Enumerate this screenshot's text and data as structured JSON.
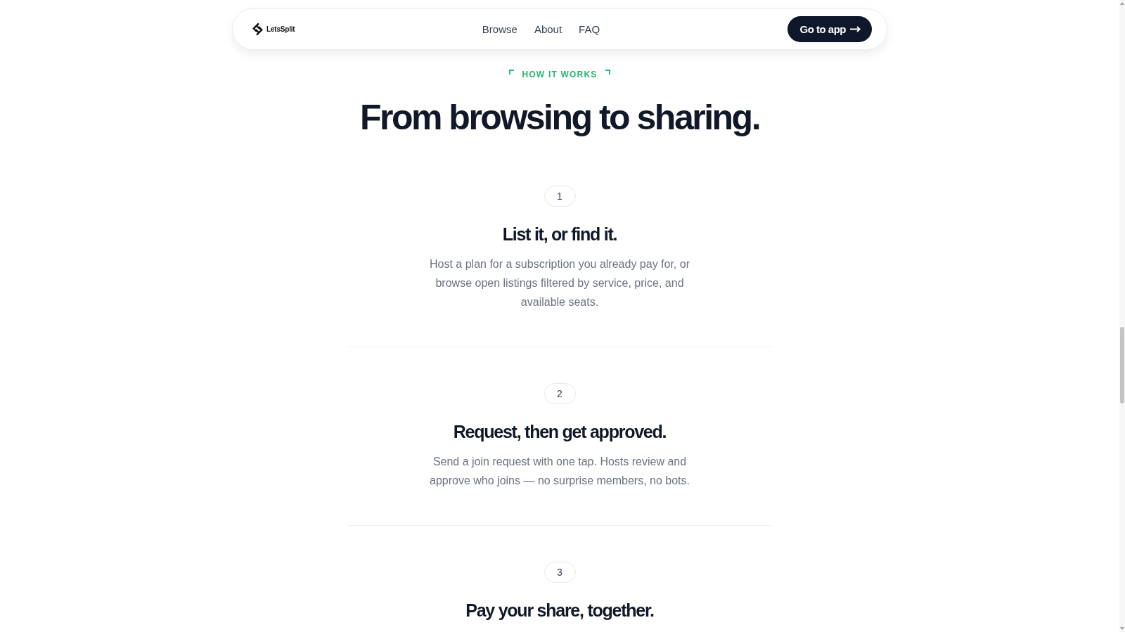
{
  "nav": {
    "logo_text": "LetsSplit",
    "links": [
      {
        "label": "Browse"
      },
      {
        "label": "About"
      },
      {
        "label": "FAQ"
      }
    ],
    "cta": {
      "label": "Go to app"
    }
  },
  "section": {
    "eyebrow": "HOW IT WORKS",
    "title": "From browsing to sharing.",
    "steps": [
      {
        "number": "1",
        "title": "List it, or find it.",
        "description": "Host a plan for a subscription you already pay for, or browse open listings filtered by service, price, and available seats."
      },
      {
        "number": "2",
        "title": "Request, then get approved.",
        "description": "Send a join request with one tap. Hosts review and approve who joins — no surprise members, no bots."
      },
      {
        "number": "3",
        "title": "Pay your share, together."
      }
    ]
  }
}
